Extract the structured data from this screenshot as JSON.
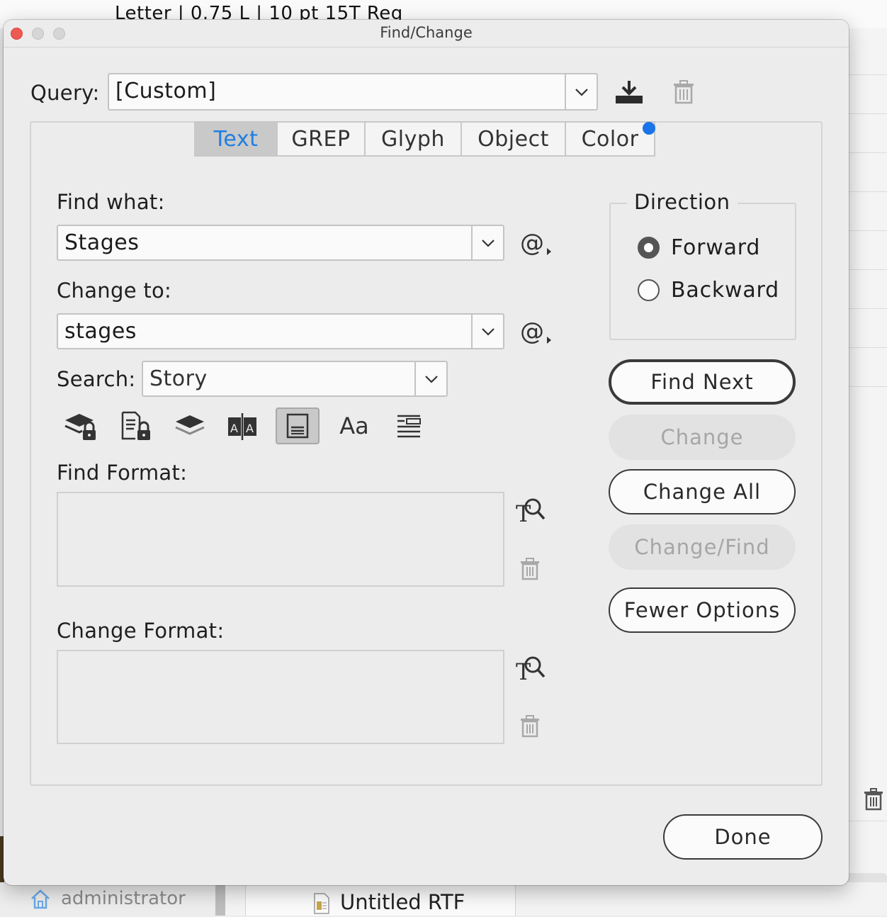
{
  "background": {
    "top_text": "Letter | 0.75 L | 10 pt 15T Reg",
    "sidebar_user": "administrator",
    "document_tab": "Untitled RTF"
  },
  "window": {
    "title": "Find/Change"
  },
  "query": {
    "label": "Query:",
    "value": "[Custom]"
  },
  "tabs": [
    {
      "label": "Text",
      "active": true
    },
    {
      "label": "GREP",
      "active": false
    },
    {
      "label": "Glyph",
      "active": false
    },
    {
      "label": "Object",
      "active": false
    },
    {
      "label": "Color",
      "active": false
    }
  ],
  "find_what": {
    "label": "Find what:",
    "value": "Stages"
  },
  "change_to": {
    "label": "Change to:",
    "value": "stages"
  },
  "search": {
    "label": "Search:",
    "value": "Story"
  },
  "search_options": [
    {
      "icon": "include-locked-layers-icon",
      "selected": false
    },
    {
      "icon": "include-locked-stories-icon",
      "selected": false
    },
    {
      "icon": "include-hidden-layers-icon",
      "selected": false
    },
    {
      "icon": "include-master-pages-icon",
      "selected": false
    },
    {
      "icon": "include-footnotes-icon",
      "selected": true
    },
    {
      "icon": "case-sensitive-icon",
      "label": "Aa",
      "selected": false
    },
    {
      "icon": "whole-word-icon",
      "selected": false
    }
  ],
  "find_format": {
    "label": "Find Format:"
  },
  "change_format": {
    "label": "Change Format:"
  },
  "direction": {
    "title": "Direction",
    "options": [
      {
        "label": "Forward",
        "selected": true
      },
      {
        "label": "Backward",
        "selected": false
      }
    ]
  },
  "buttons": {
    "find_next": "Find Next",
    "change": "Change",
    "change_all": "Change All",
    "change_find": "Change/Find",
    "fewer_options": "Fewer Options",
    "done": "Done"
  },
  "colors": {
    "accent": "#1a73e8",
    "active_tab_text": "#1f7ee0",
    "close_button": "#ee5a52"
  }
}
